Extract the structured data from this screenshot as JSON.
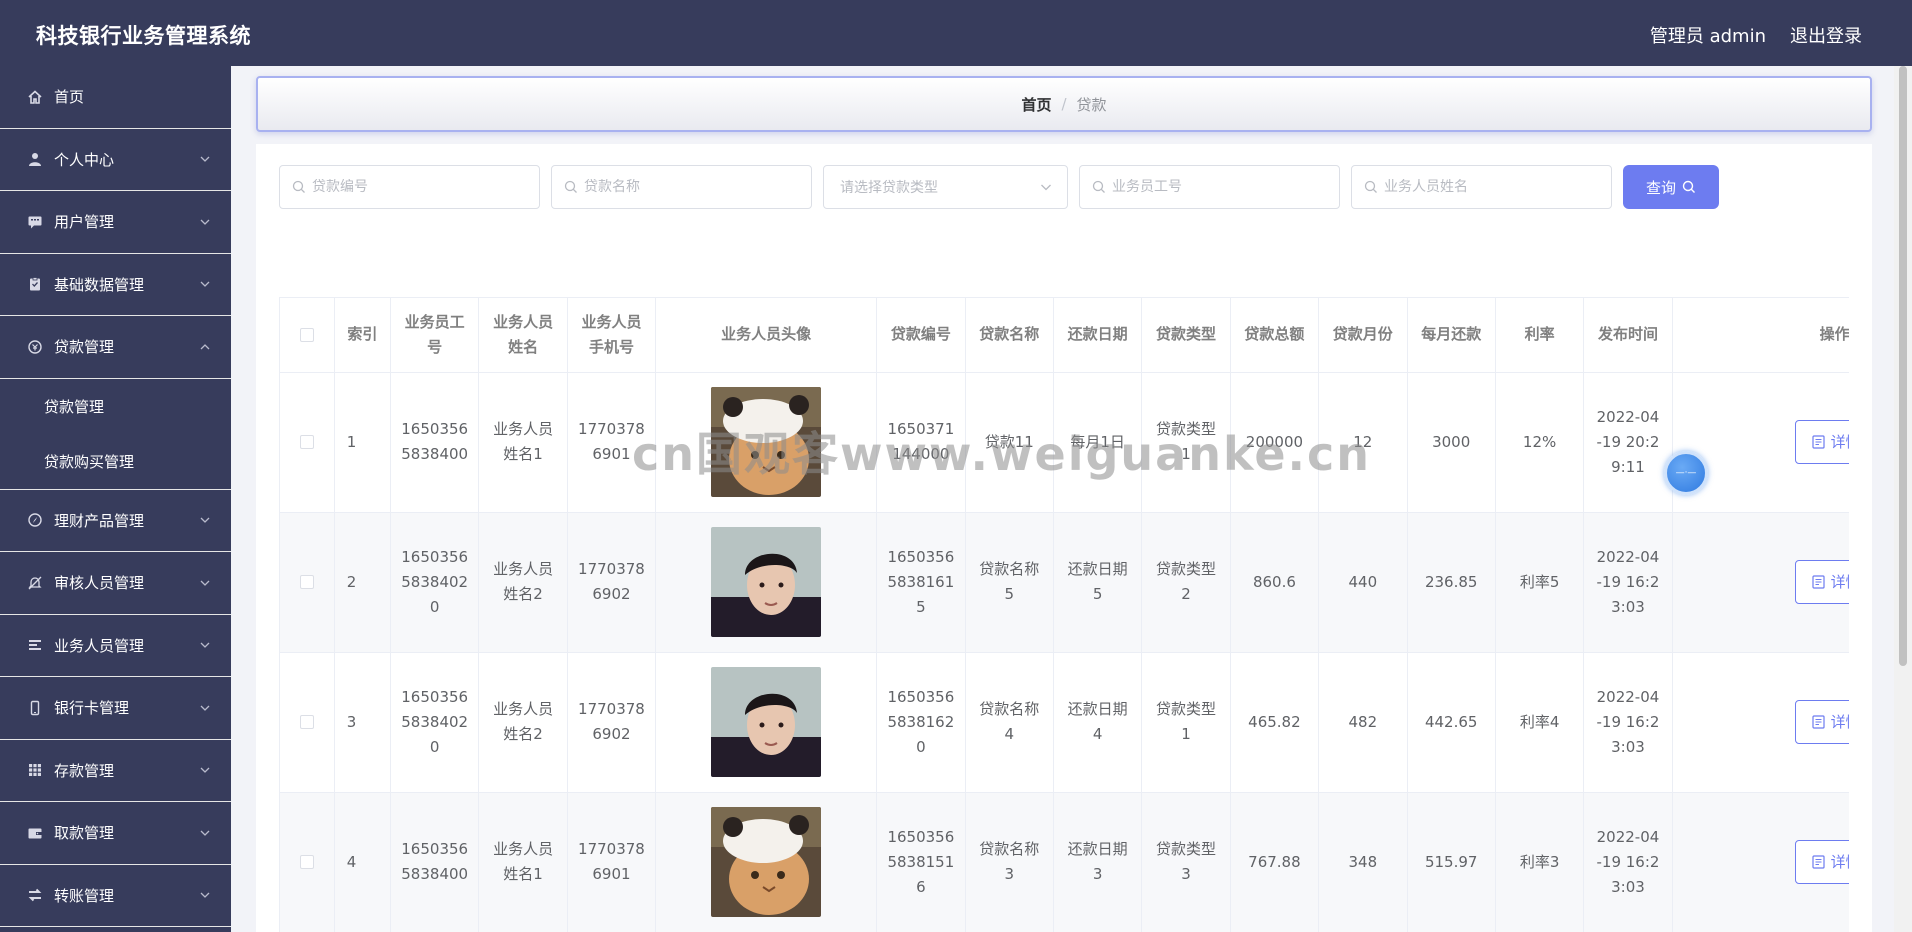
{
  "header": {
    "app_title": "科技银行业务管理系统",
    "admin_label": "管理员 admin",
    "logout_label": "退出登录"
  },
  "sidebar": {
    "items": [
      {
        "label": "首页",
        "icon": "home-icon"
      },
      {
        "label": "个人中心",
        "icon": "user-icon"
      },
      {
        "label": "用户管理",
        "icon": "chat-icon"
      },
      {
        "label": "基础数据管理",
        "icon": "clipboard-icon"
      },
      {
        "label": "贷款管理",
        "icon": "money-icon",
        "expanded": true,
        "children": [
          "贷款管理",
          "贷款购买管理"
        ]
      },
      {
        "label": "理财产品管理",
        "icon": "compass-icon"
      },
      {
        "label": "审核人员管理",
        "icon": "bell-off-icon"
      },
      {
        "label": "业务人员管理",
        "icon": "list-icon"
      },
      {
        "label": "银行卡管理",
        "icon": "phone-icon"
      },
      {
        "label": "存款管理",
        "icon": "grid-icon"
      },
      {
        "label": "取款管理",
        "icon": "wallet-icon"
      },
      {
        "label": "转账管理",
        "icon": "transfer-icon"
      }
    ]
  },
  "breadcrumb": {
    "home": "首页",
    "separator": "/",
    "current": "贷款"
  },
  "search": {
    "loan_code_placeholder": "贷款编号",
    "loan_name_placeholder": "贷款名称",
    "loan_type_placeholder": "请选择贷款类型",
    "staff_no_placeholder": "业务员工号",
    "staff_name_placeholder": "业务人员姓名",
    "query_label": "查询"
  },
  "table": {
    "headers": [
      "索引",
      "业务员工号",
      "业务人员姓名",
      "业务人员手机号",
      "业务人员头像",
      "贷款编号",
      "贷款名称",
      "还款日期",
      "贷款类型",
      "贷款总额",
      "贷款月份",
      "每月还款",
      "利率",
      "发布时间",
      "操作"
    ],
    "detail_label": "详情",
    "rows": [
      {
        "index": "1",
        "staff_no": "16503565838400",
        "staff_name": "业务人员姓名1",
        "staff_phone": "17703786901",
        "avatar": "cat",
        "loan_code": "1650371144000",
        "loan_name": "贷款11",
        "repay_date": "每月1日",
        "loan_type": "贷款类型1",
        "total": "200000",
        "months": "12",
        "monthly": "3000",
        "rate": "12%",
        "published": "2022-04-19 20:29:11"
      },
      {
        "index": "2",
        "staff_no": "165035658384020",
        "staff_name": "业务人员姓名2",
        "staff_phone": "17703786902",
        "avatar": "man",
        "loan_code": "165035658381615",
        "loan_name": "贷款名称5",
        "repay_date": "还款日期5",
        "loan_type": "贷款类型2",
        "total": "860.6",
        "months": "440",
        "monthly": "236.85",
        "rate": "利率5",
        "published": "2022-04-19 16:23:03"
      },
      {
        "index": "3",
        "staff_no": "165035658384020",
        "staff_name": "业务人员姓名2",
        "staff_phone": "17703786902",
        "avatar": "man",
        "loan_code": "165035658381620",
        "loan_name": "贷款名称4",
        "repay_date": "还款日期4",
        "loan_type": "贷款类型1",
        "total": "465.82",
        "months": "482",
        "monthly": "442.65",
        "rate": "利率4",
        "published": "2022-04-19 16:23:03"
      },
      {
        "index": "4",
        "staff_no": "16503565838400",
        "staff_name": "业务人员姓名1",
        "staff_phone": "17703786901",
        "avatar": "cat",
        "loan_code": "165035658381516",
        "loan_name": "贷款名称3",
        "repay_date": "还款日期3",
        "loan_type": "贷款类型3",
        "total": "767.88",
        "months": "348",
        "monthly": "515.97",
        "rate": "利率3",
        "published": "2022-04-19 16:23:03"
      }
    ]
  },
  "watermark": "cn国观客www.weiguanke.cn",
  "float_ball_label": "—·—"
}
